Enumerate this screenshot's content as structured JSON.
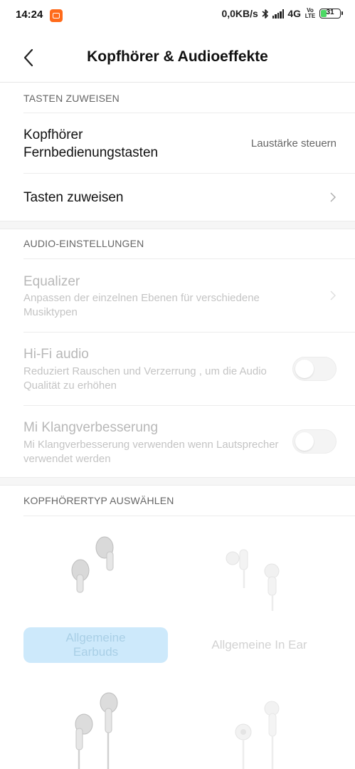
{
  "status_bar": {
    "time": "14:24",
    "network_speed": "0,0KB/s",
    "network_type": "4G",
    "volte_line1": "Vo",
    "volte_line2": "LTE",
    "battery": "31",
    "battery_level_percent": 31,
    "icons": [
      "app-notification-icon",
      "bluetooth-icon",
      "signal-icon",
      "battery-icon"
    ]
  },
  "header": {
    "title": "Kopfhörer & Audioeffekte",
    "back_icon": "back-arrow-icon"
  },
  "sections": {
    "tasten": {
      "header": "TASTEN ZUWEISEN",
      "remote_title_line1": "Kopfhörer",
      "remote_title_line2": "Fernbedienungstasten",
      "remote_value": "Laustärke steuern",
      "assign_title": "Tasten zuweisen"
    },
    "audio": {
      "header": "AUDIO-EINSTELLUNGEN",
      "equalizer_title": "Equalizer",
      "equalizer_sub": "Anpassen der einzelnen Ebenen für verschiedene Musiktypen",
      "hifi_title": "Hi-Fi audio",
      "hifi_sub": "Reduziert Rauschen und Verzerrung , um die Audio Qualität zu erhöhen",
      "hifi_enabled": false,
      "mi_title": "Mi Klangverbesserung",
      "mi_sub": "Mi Klangverbesserung verwenden wenn Lautsprecher verwendet werden",
      "mi_enabled": false
    },
    "kopfhoerertyp": {
      "header": "KOPFHÖRERTYP AUSWÄHLEN",
      "types": [
        {
          "label": "Allgemeine Earbuds",
          "selected": true
        },
        {
          "label": "Allgemeine In Ear",
          "selected": false
        }
      ]
    }
  },
  "colors": {
    "selected_type_bg": "#cde9fb",
    "battery_green": "#4cd964",
    "app_icon": "#ff6a1a"
  }
}
